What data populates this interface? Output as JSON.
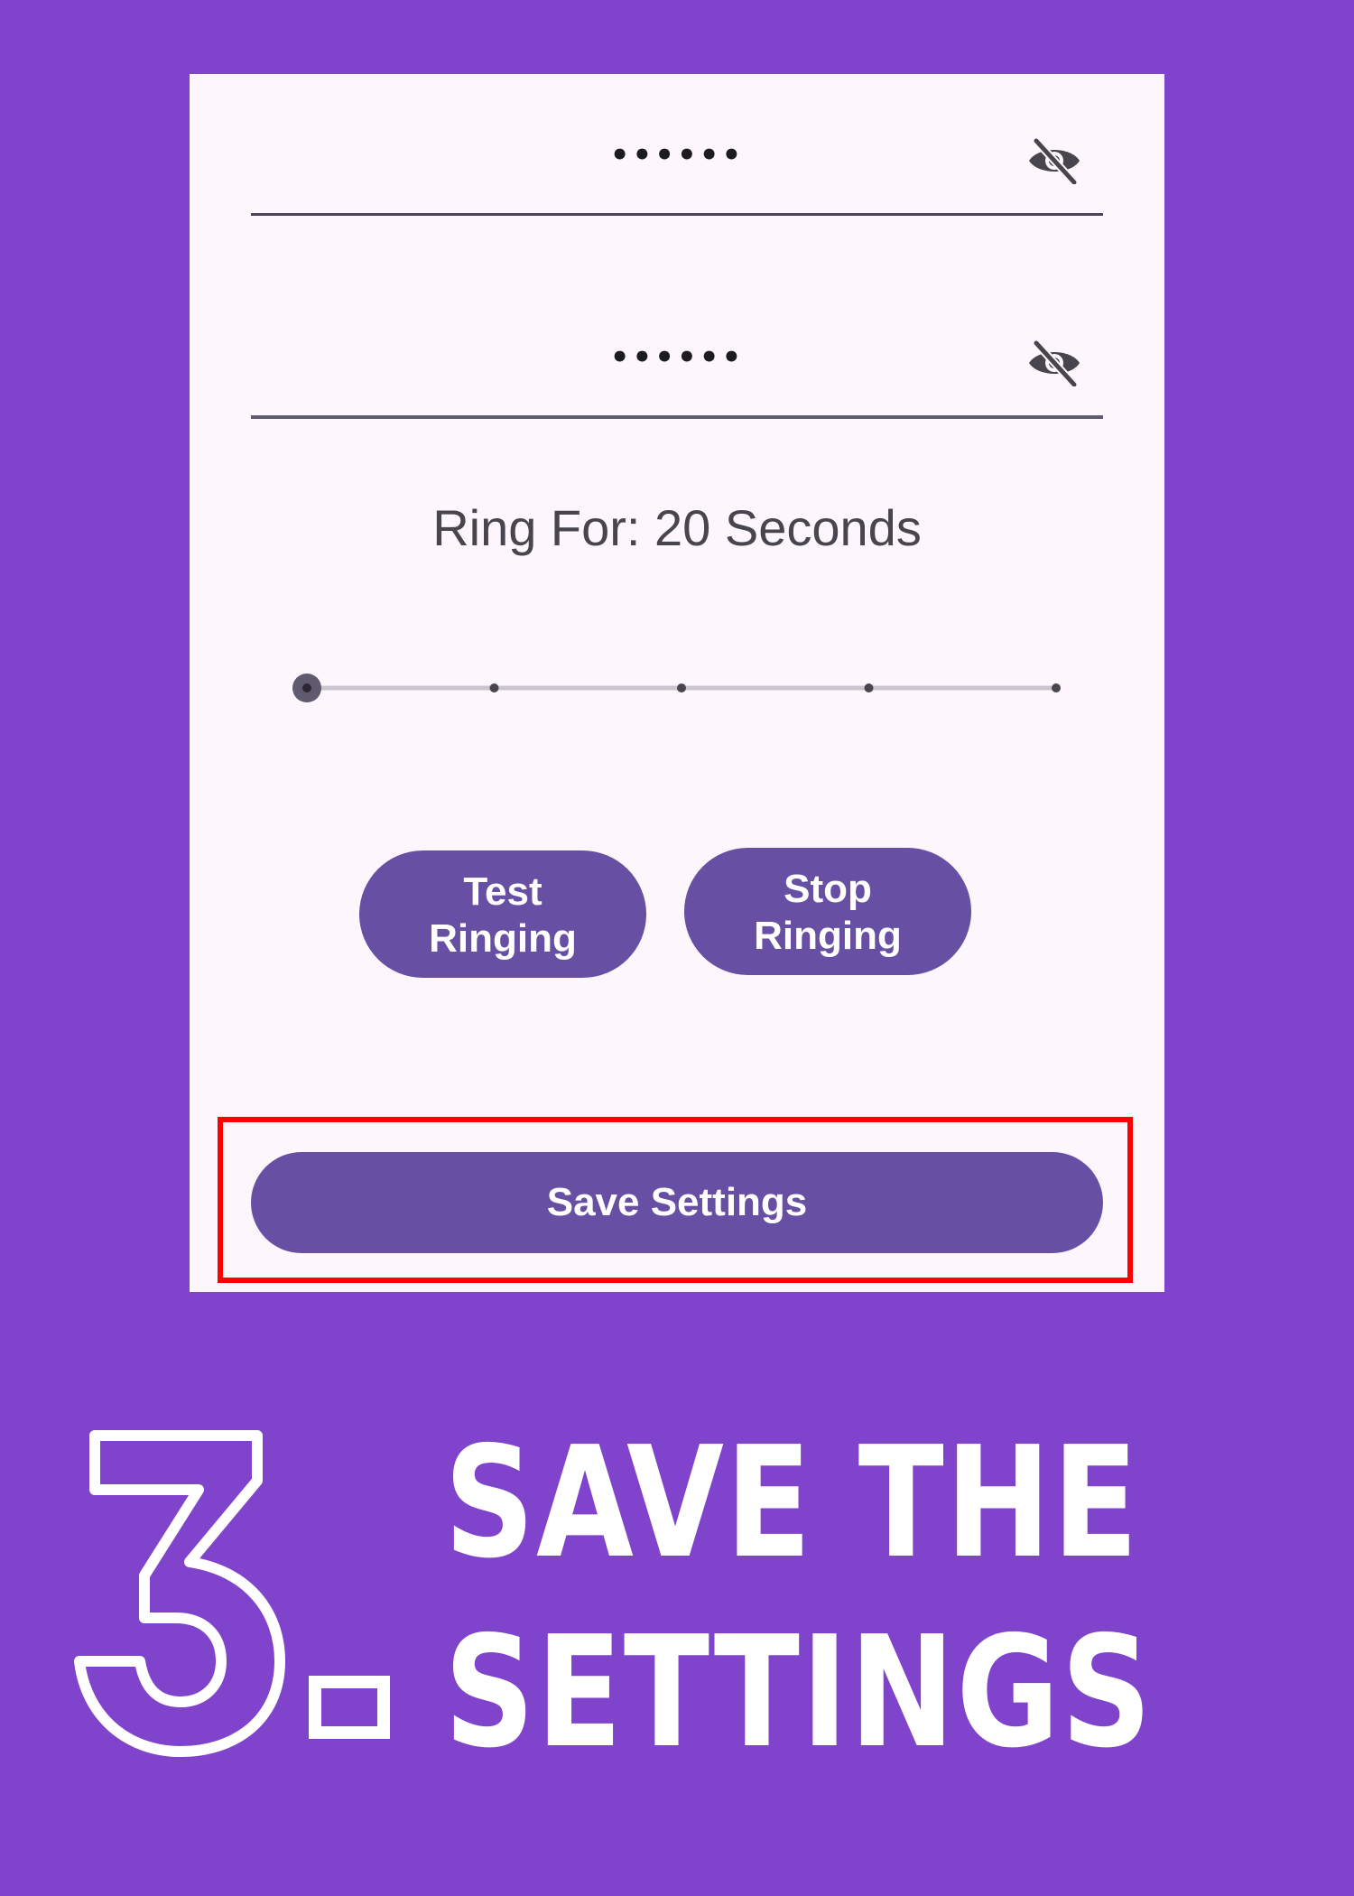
{
  "form": {
    "password_field_1": {
      "masked_value": "••••••",
      "toggle_icon": "eye-off-icon"
    },
    "password_field_2": {
      "masked_value": "••••••",
      "toggle_icon": "eye-off-icon"
    },
    "ring_label": "Ring For: 20 Seconds",
    "slider": {
      "steps": 5,
      "selected_index": 0
    },
    "test_button": {
      "line1": "Test",
      "line2": "Ringing"
    },
    "stop_button": {
      "line1": "Stop",
      "line2": "Ringing"
    },
    "save_button": "Save Settings"
  },
  "caption": {
    "step_number": "3",
    "line1": "SAVE THE",
    "line2": "SETTINGS"
  },
  "colors": {
    "background": "#8043cc",
    "panel": "#fdf7fd",
    "button": "#6750a4",
    "highlight": "#ff0000"
  }
}
